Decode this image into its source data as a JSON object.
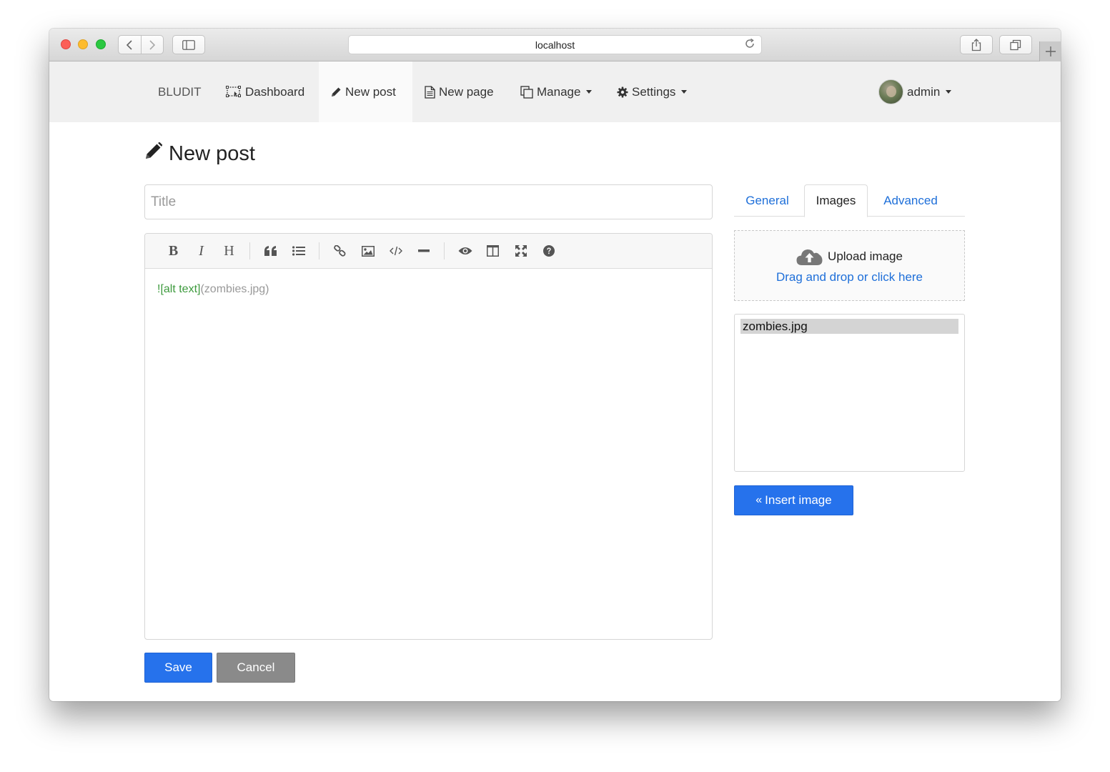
{
  "browser": {
    "url": "localhost"
  },
  "navbar": {
    "brand": "BLUDIT",
    "items": [
      {
        "label": "Dashboard",
        "icon": "dashboard-icon"
      },
      {
        "label": "New post",
        "icon": "pencil-icon",
        "active": true
      },
      {
        "label": "New page",
        "icon": "file-icon"
      },
      {
        "label": "Manage",
        "icon": "copy-icon",
        "dropdown": true
      },
      {
        "label": "Settings",
        "icon": "gear-icon",
        "dropdown": true
      }
    ],
    "user": "admin"
  },
  "page": {
    "title": "New post",
    "title_placeholder": "Title"
  },
  "editor": {
    "content_alt": "![alt text]",
    "content_url": "(zombies.jpg)",
    "toolbar": [
      "bold",
      "italic",
      "heading",
      "quote",
      "unordered-list",
      "link",
      "image",
      "code",
      "horizontal-rule",
      "preview",
      "side-by-side",
      "fullscreen",
      "guide"
    ]
  },
  "actions": {
    "save": "Save",
    "cancel": "Cancel"
  },
  "sidebar": {
    "tabs": [
      {
        "label": "General"
      },
      {
        "label": "Images",
        "active": true
      },
      {
        "label": "Advanced"
      }
    ],
    "upload": {
      "label": "Upload image",
      "hint": "Drag and drop or click here"
    },
    "images": [
      "zombies.jpg"
    ],
    "insert_label": "Insert image"
  },
  "colors": {
    "primary": "#2672ec",
    "link": "#1e6fd9",
    "markdown_alt": "#3d9a3d",
    "cancel": "#8a8a8a"
  }
}
